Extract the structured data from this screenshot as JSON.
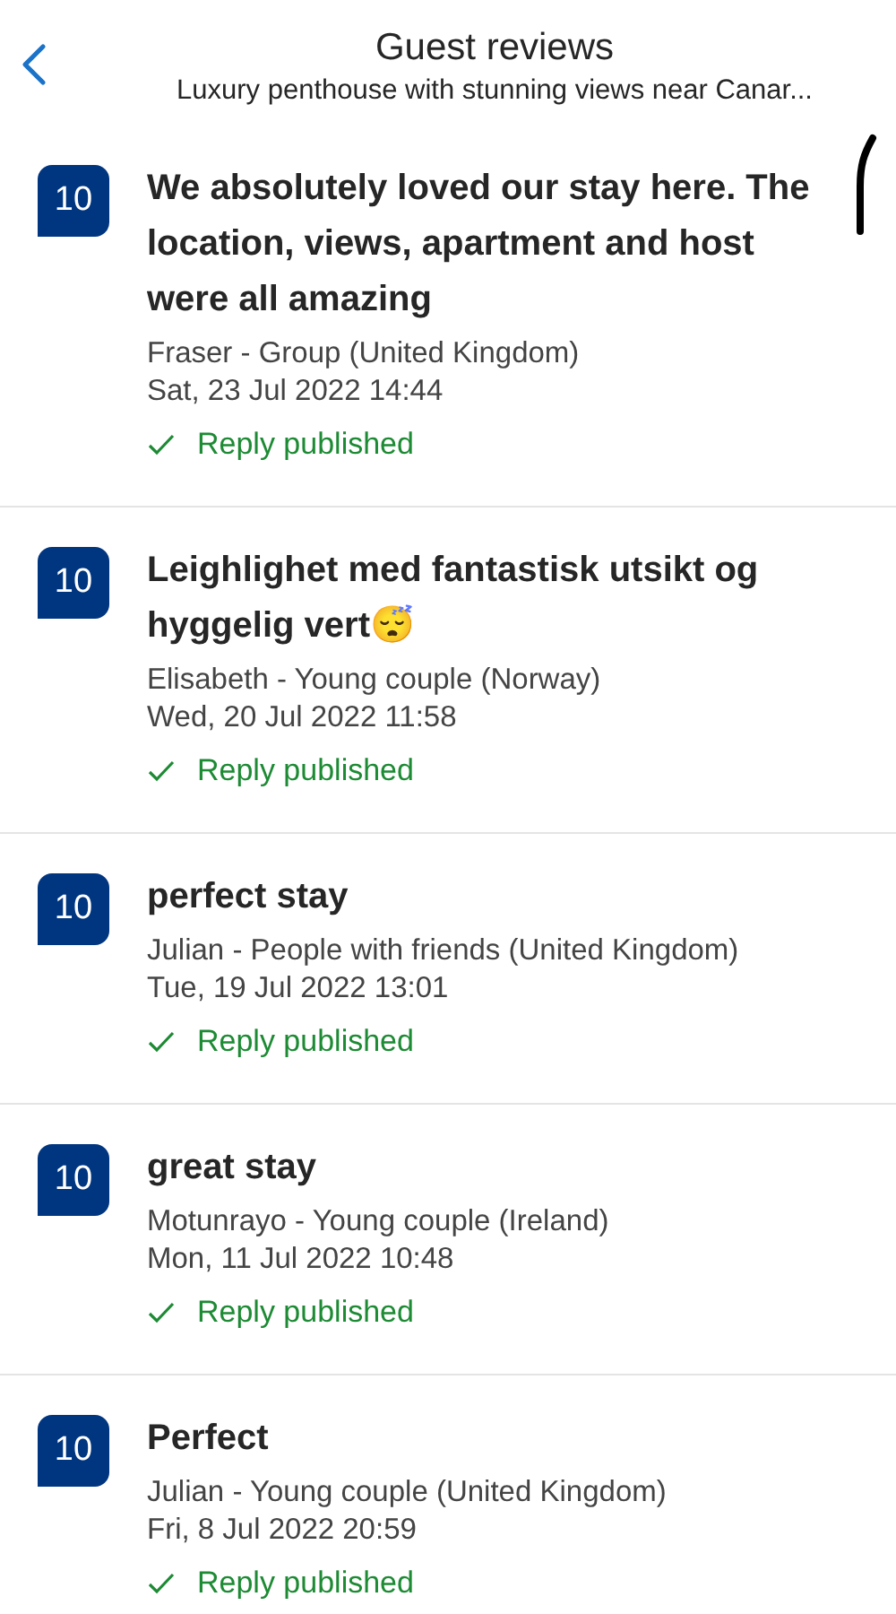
{
  "header": {
    "title": "Guest reviews",
    "subtitle": "Luxury penthouse with stunning views near Canar..."
  },
  "reviews": [
    {
      "score": "10",
      "title": "We absolutely loved our stay here. The location, views, apartment and host were all amazing",
      "guest": "Fraser - Group (United Kingdom)",
      "date": "Sat, 23 Jul 2022 14:44",
      "status": "Reply published",
      "mark": true
    },
    {
      "score": "10",
      "title": "Leighlighet med fantastisk utsikt og hyggelig vert😴",
      "guest": "Elisabeth - Young couple (Norway)",
      "date": "Wed, 20 Jul 2022 11:58",
      "status": "Reply published",
      "mark": false
    },
    {
      "score": "10",
      "title": "perfect stay",
      "guest": "Julian - People with friends (United Kingdom)",
      "date": "Tue, 19 Jul 2022 13:01",
      "status": "Reply published",
      "mark": false
    },
    {
      "score": "10",
      "title": "great stay",
      "guest": "Motunrayo - Young couple (Ireland)",
      "date": "Mon, 11 Jul 2022 10:48",
      "status": "Reply published",
      "mark": false
    },
    {
      "score": "10",
      "title": "Perfect",
      "guest": "Julian - Young couple (United Kingdom)",
      "date": "Fri, 8 Jul 2022 20:59",
      "status": "Reply published",
      "mark": false
    }
  ]
}
